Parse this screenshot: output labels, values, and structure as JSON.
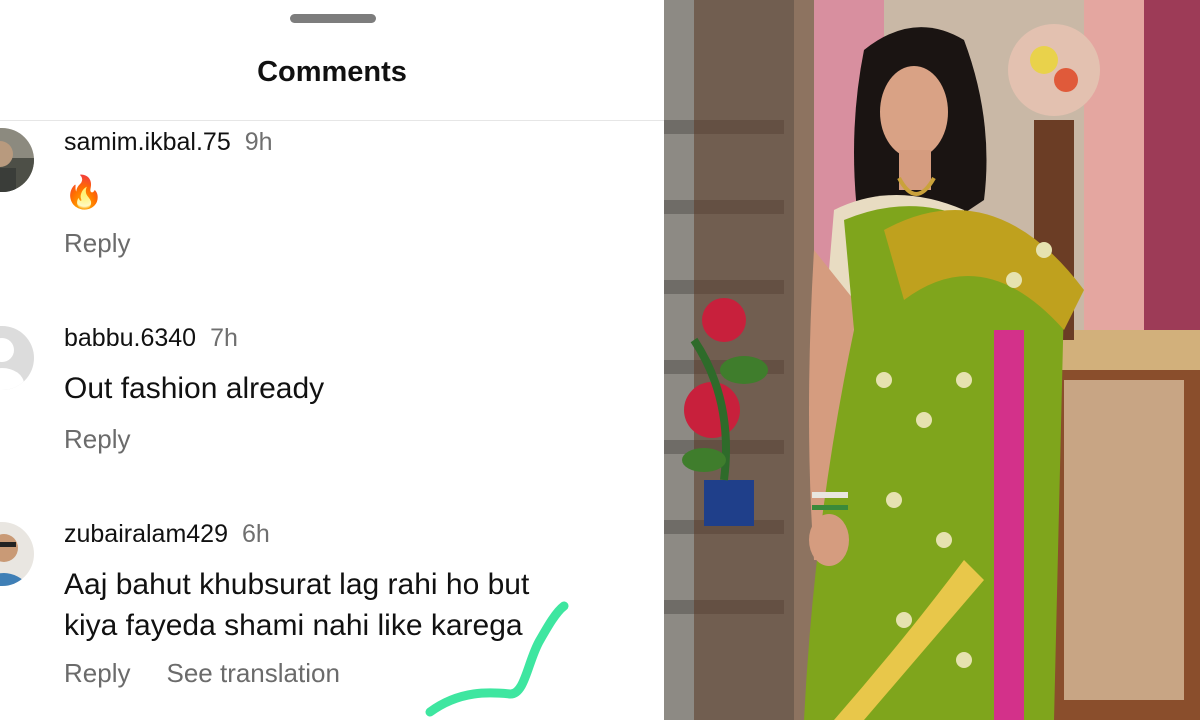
{
  "sheet": {
    "title": "Comments"
  },
  "comments": [
    {
      "username": "samim.ikbal.75",
      "time": "9h",
      "text": "🔥",
      "actions": [
        "Reply"
      ]
    },
    {
      "username": "babbu.6340",
      "time": "7h",
      "text": "Out fashion already",
      "actions": [
        "Reply"
      ]
    },
    {
      "username": "zubairalam429",
      "time": "6h",
      "text_lines": [
        "Aaj bahut khubsurat lag rahi ho but",
        "kiya fayeda shami nahi like karega"
      ],
      "actions": [
        "Reply",
        "See translation"
      ]
    }
  ],
  "photo": {
    "subject": "woman in green saree",
    "colors": {
      "saree": "#7fa51c",
      "border": "#d3318a",
      "wall": "#c9b8a6"
    }
  },
  "annotation": {
    "color": "#3ee6a0"
  }
}
